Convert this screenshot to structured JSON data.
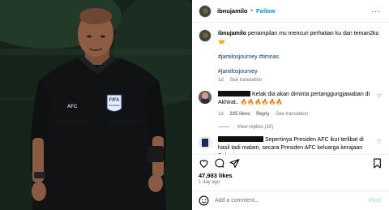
{
  "header": {
    "username": "ibnujamilo",
    "separator": "•",
    "follow_label": "Follow",
    "more_label": "..."
  },
  "caption": {
    "username": "ibnujamilo",
    "text": "penampilan mu mencuri perhatian ku dan teman2ku 🤝",
    "tag_line_1": "#jamilosjourney #timnas",
    "tag_line_2": "#jamilosjourney",
    "time": "1d",
    "see_translation": "See translation"
  },
  "comments": [
    {
      "text": "Kelak dia akan diminta pertanggungjawaban di Akhirat.. 🔥🔥🔥🔥🔥🔥",
      "time": "1d",
      "likes": "225 likes",
      "reply": "Reply",
      "see_translation": "See translation",
      "view_replies": "View replies (10)"
    },
    {
      "text": "Sepertinya Presiden AFC ikut terlibat di hasil tadi malam, secara Presiden AFC keluarga kerajaan Bahrain"
    }
  ],
  "post": {
    "likes": "47,983 likes",
    "time_ago": "1 day ago"
  },
  "add_comment": {
    "placeholder": "Add a comment...",
    "post_label": "Post"
  },
  "media": {
    "badge_text": "FIFA",
    "badge_sub": "REFEREE",
    "crest_text": "AFC"
  },
  "colors": {
    "follow": "#0095f6",
    "hashtag": "#00376b",
    "muted": "#737373",
    "post_disabled": "#b2dffc"
  }
}
